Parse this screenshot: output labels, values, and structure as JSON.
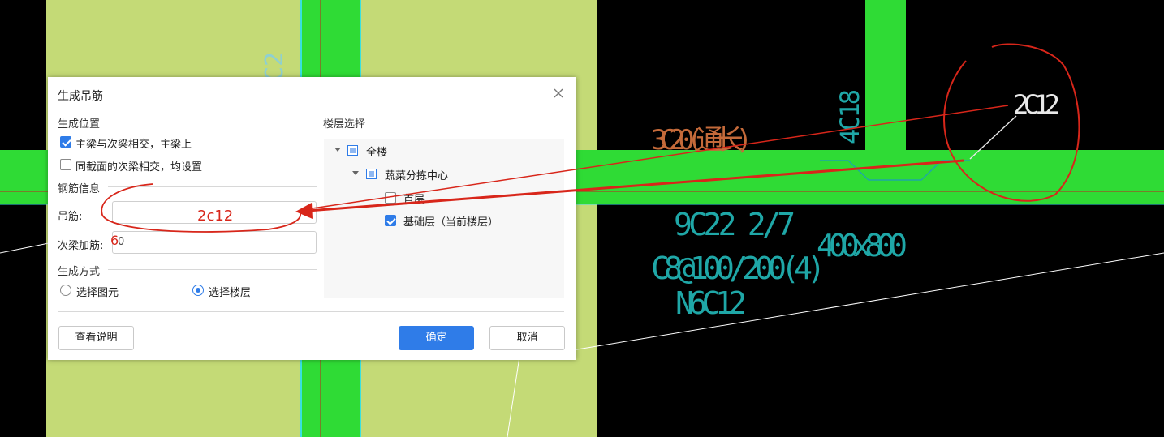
{
  "cad": {
    "labels": {
      "top_rot": "C2",
      "rebar_4c18": "4C18",
      "rebar_3c20": "3C20(通长)",
      "beam_bottom": "9C22 2/7",
      "beam_size": "400x800",
      "stirrup": "C8@100/200(4)",
      "torsion": "N6C12"
    },
    "annotation": {
      "callout_2c12": "2C12",
      "typed_2c12": "2c12"
    },
    "colors": {
      "background": "#000000",
      "slab": "#c4da76",
      "beam": "#2fdb35",
      "cyan_text": "#1fa7a7",
      "red_annot": "#d8261a"
    }
  },
  "dialog": {
    "title": "生成吊筋",
    "close_icon": "close-icon",
    "position_section": "生成位置",
    "opt_main_secondary": "主梁与次梁相交，主梁上",
    "opt_main_secondary_checked": true,
    "opt_same_section": "同截面的次梁相交，均设置",
    "opt_same_section_checked": false,
    "rebar_section": "钢筋信息",
    "hanger_label": "吊筋:",
    "hanger_value": "",
    "extra_label": "次梁加筋:",
    "extra_value": "0",
    "extra_overlay": "6",
    "mode_section": "生成方式",
    "mode_element": "选择图元",
    "mode_floor": "选择楼层",
    "mode_selected": "floor",
    "floor_section": "楼层选择",
    "tree": [
      {
        "label": "全楼",
        "type": "node"
      },
      {
        "label": "蔬菜分拣中心",
        "type": "node"
      },
      {
        "label": "首层",
        "type": "check",
        "checked": false
      },
      {
        "label": "基础层（当前楼层）",
        "type": "check",
        "checked": true
      }
    ],
    "help_button": "查看说明",
    "ok_button": "确定",
    "cancel_button": "取消"
  }
}
